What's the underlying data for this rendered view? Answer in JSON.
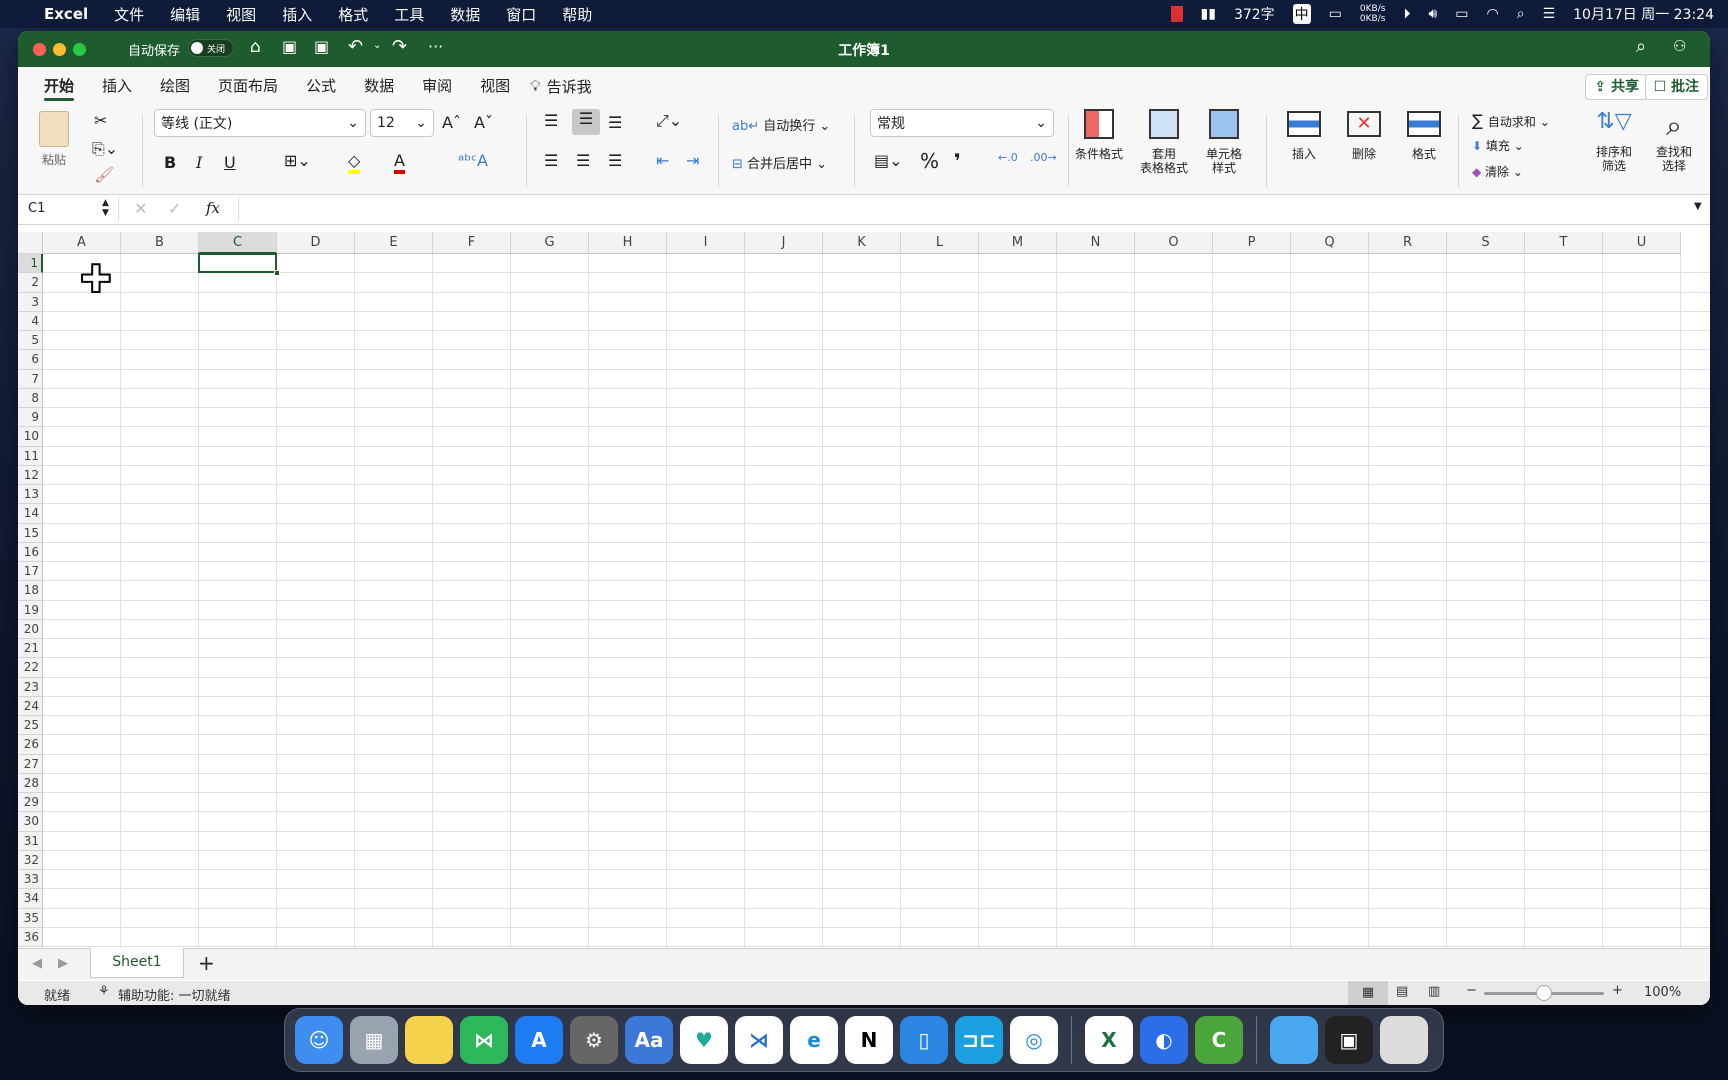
{
  "menubar": {
    "app": "Excel",
    "items": [
      "文件",
      "编辑",
      "视图",
      "插入",
      "格式",
      "工具",
      "数据",
      "窗口",
      "帮助"
    ],
    "word_count": "372字",
    "ime": "中",
    "net_up": "0KB/s",
    "net_down": "0KB/s",
    "datetime": "10月17日 周一  23:24"
  },
  "window": {
    "title": "工作簿1",
    "autosave_label": "自动保存",
    "autosave_state": "关闭"
  },
  "tabs": [
    "开始",
    "插入",
    "绘图",
    "页面布局",
    "公式",
    "数据",
    "审阅",
    "视图"
  ],
  "tell_me": "告诉我",
  "share": "共享",
  "comments": "批注",
  "ribbon": {
    "paste": "粘贴",
    "font": "等线 (正文)",
    "size": "12",
    "bold": "B",
    "italic": "I",
    "underline": "U",
    "wrap": "自动换行",
    "merge": "合并后居中",
    "number_format": "常规",
    "percent": "%",
    "comma": "❜",
    "cond_format": "条件格式",
    "table_format_1": "套用",
    "table_format_2": "表格格式",
    "cell_style_1": "单元格",
    "cell_style_2": "样式",
    "insert": "插入",
    "delete": "删除",
    "format": "格式",
    "autosum": "自动求和",
    "fill": "填充",
    "clear": "清除",
    "sort_1": "排序和",
    "sort_2": "筛选",
    "find_1": "查找和",
    "find_2": "选择"
  },
  "formula": {
    "name_box": "C1",
    "fx": "fx",
    "value": ""
  },
  "columns": [
    "A",
    "B",
    "C",
    "D",
    "E",
    "F",
    "G",
    "H",
    "I",
    "J",
    "K",
    "L",
    "M",
    "N",
    "O",
    "P",
    "Q",
    "R",
    "S",
    "T",
    "U"
  ],
  "rows": [
    "1",
    "2",
    "3",
    "4",
    "5",
    "6",
    "7",
    "8",
    "9",
    "10",
    "11",
    "12",
    "13",
    "14",
    "15",
    "16",
    "17",
    "18",
    "19",
    "20",
    "21",
    "22",
    "23",
    "24",
    "25",
    "26",
    "27",
    "28",
    "29",
    "30",
    "31",
    "32",
    "33",
    "34",
    "35",
    "36"
  ],
  "selected_cell": "C1",
  "sheet_tab": "Sheet1",
  "status": {
    "ready": "就绪",
    "accessibility": "辅助功能: 一切就绪",
    "zoom": "100%",
    "zoom_fraction": 0.5
  },
  "dock": [
    "Finder",
    "Launchpad",
    "Notes",
    "MindNode",
    "App Store",
    "System Preferences",
    "Dictionary",
    "Health",
    "VS Code",
    "Edge",
    "Notion",
    "Reader",
    "Jump",
    "Safari",
    "Excel",
    "Lark",
    "Camtasia",
    "Downloads",
    "Screenshot",
    "Trash"
  ],
  "colors": {
    "accent": "#1e5c30"
  }
}
